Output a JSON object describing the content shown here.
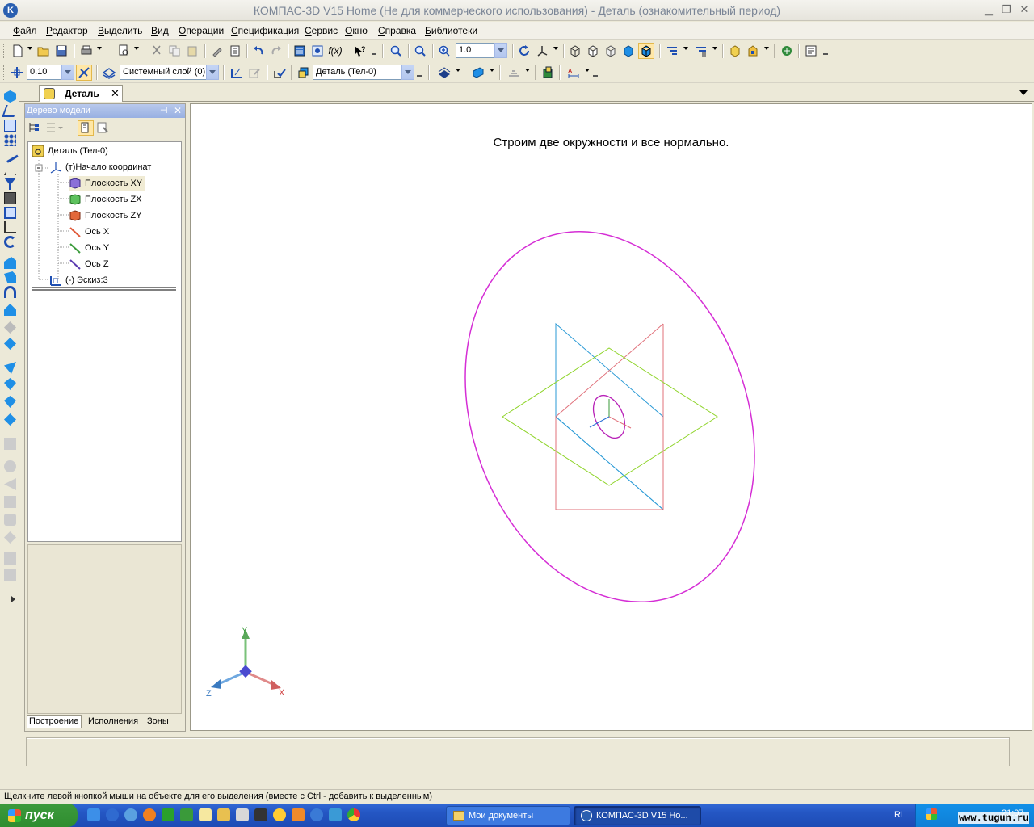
{
  "window": {
    "title": "КОМПАС-3D V15 Home (Не для коммерческого использования) - Деталь (ознакомительный период)",
    "logo": "K"
  },
  "menu": [
    "Файл",
    "Редактор",
    "Выделить",
    "Вид",
    "Операции",
    "Спецификация",
    "Сервис",
    "Окно",
    "Справка",
    "Библиотеки"
  ],
  "toolbar": {
    "zoom_value": "1.0",
    "step_value": "0.10",
    "layer_value": "Системный слой (0)",
    "detail_value": "Деталь (Тел-0)"
  },
  "doc_tab": {
    "label": "Деталь"
  },
  "panel": {
    "title": "Дерево модели",
    "tree": [
      {
        "label": "Деталь (Тел-0)",
        "icon": "detail-icon"
      },
      {
        "label": "(т)Начало координат",
        "icon": "origin-icon"
      },
      {
        "label": "Плоскость XY",
        "icon": "plane-xy-icon"
      },
      {
        "label": "Плоскость ZX",
        "icon": "plane-zx-icon"
      },
      {
        "label": "Плоскость ZY",
        "icon": "plane-zy-icon"
      },
      {
        "label": "Ось X",
        "icon": "axis-x-icon"
      },
      {
        "label": "Ось Y",
        "icon": "axis-y-icon"
      },
      {
        "label": "Ось Z",
        "icon": "axis-z-icon"
      },
      {
        "label": "(-) Эскиз:3",
        "icon": "sketch-icon"
      }
    ],
    "tabs": [
      "Построение",
      "Исполнения",
      "Зоны"
    ]
  },
  "canvas": {
    "caption": "Строим две окружности и все нормально.",
    "triad": {
      "x": "X",
      "y": "Y",
      "z": "Z"
    }
  },
  "colors": {
    "circle": "#d52ed5",
    "plane_xy": "#8fd42a",
    "plane_zx": "#e0707a",
    "plane_zy": "#2a9ad6"
  },
  "status": {
    "text": "Щелкните левой кнопкой мыши на объекте для его выделения (вместе с Ctrl - добавить к выделенным)"
  },
  "taskbar": {
    "start": "пуск",
    "tasks": [
      "Мои документы",
      "КОМПАС-3D V15 Ho..."
    ],
    "lang": "RL",
    "clock": "21:07",
    "watermark": "www.tugun.ru"
  }
}
